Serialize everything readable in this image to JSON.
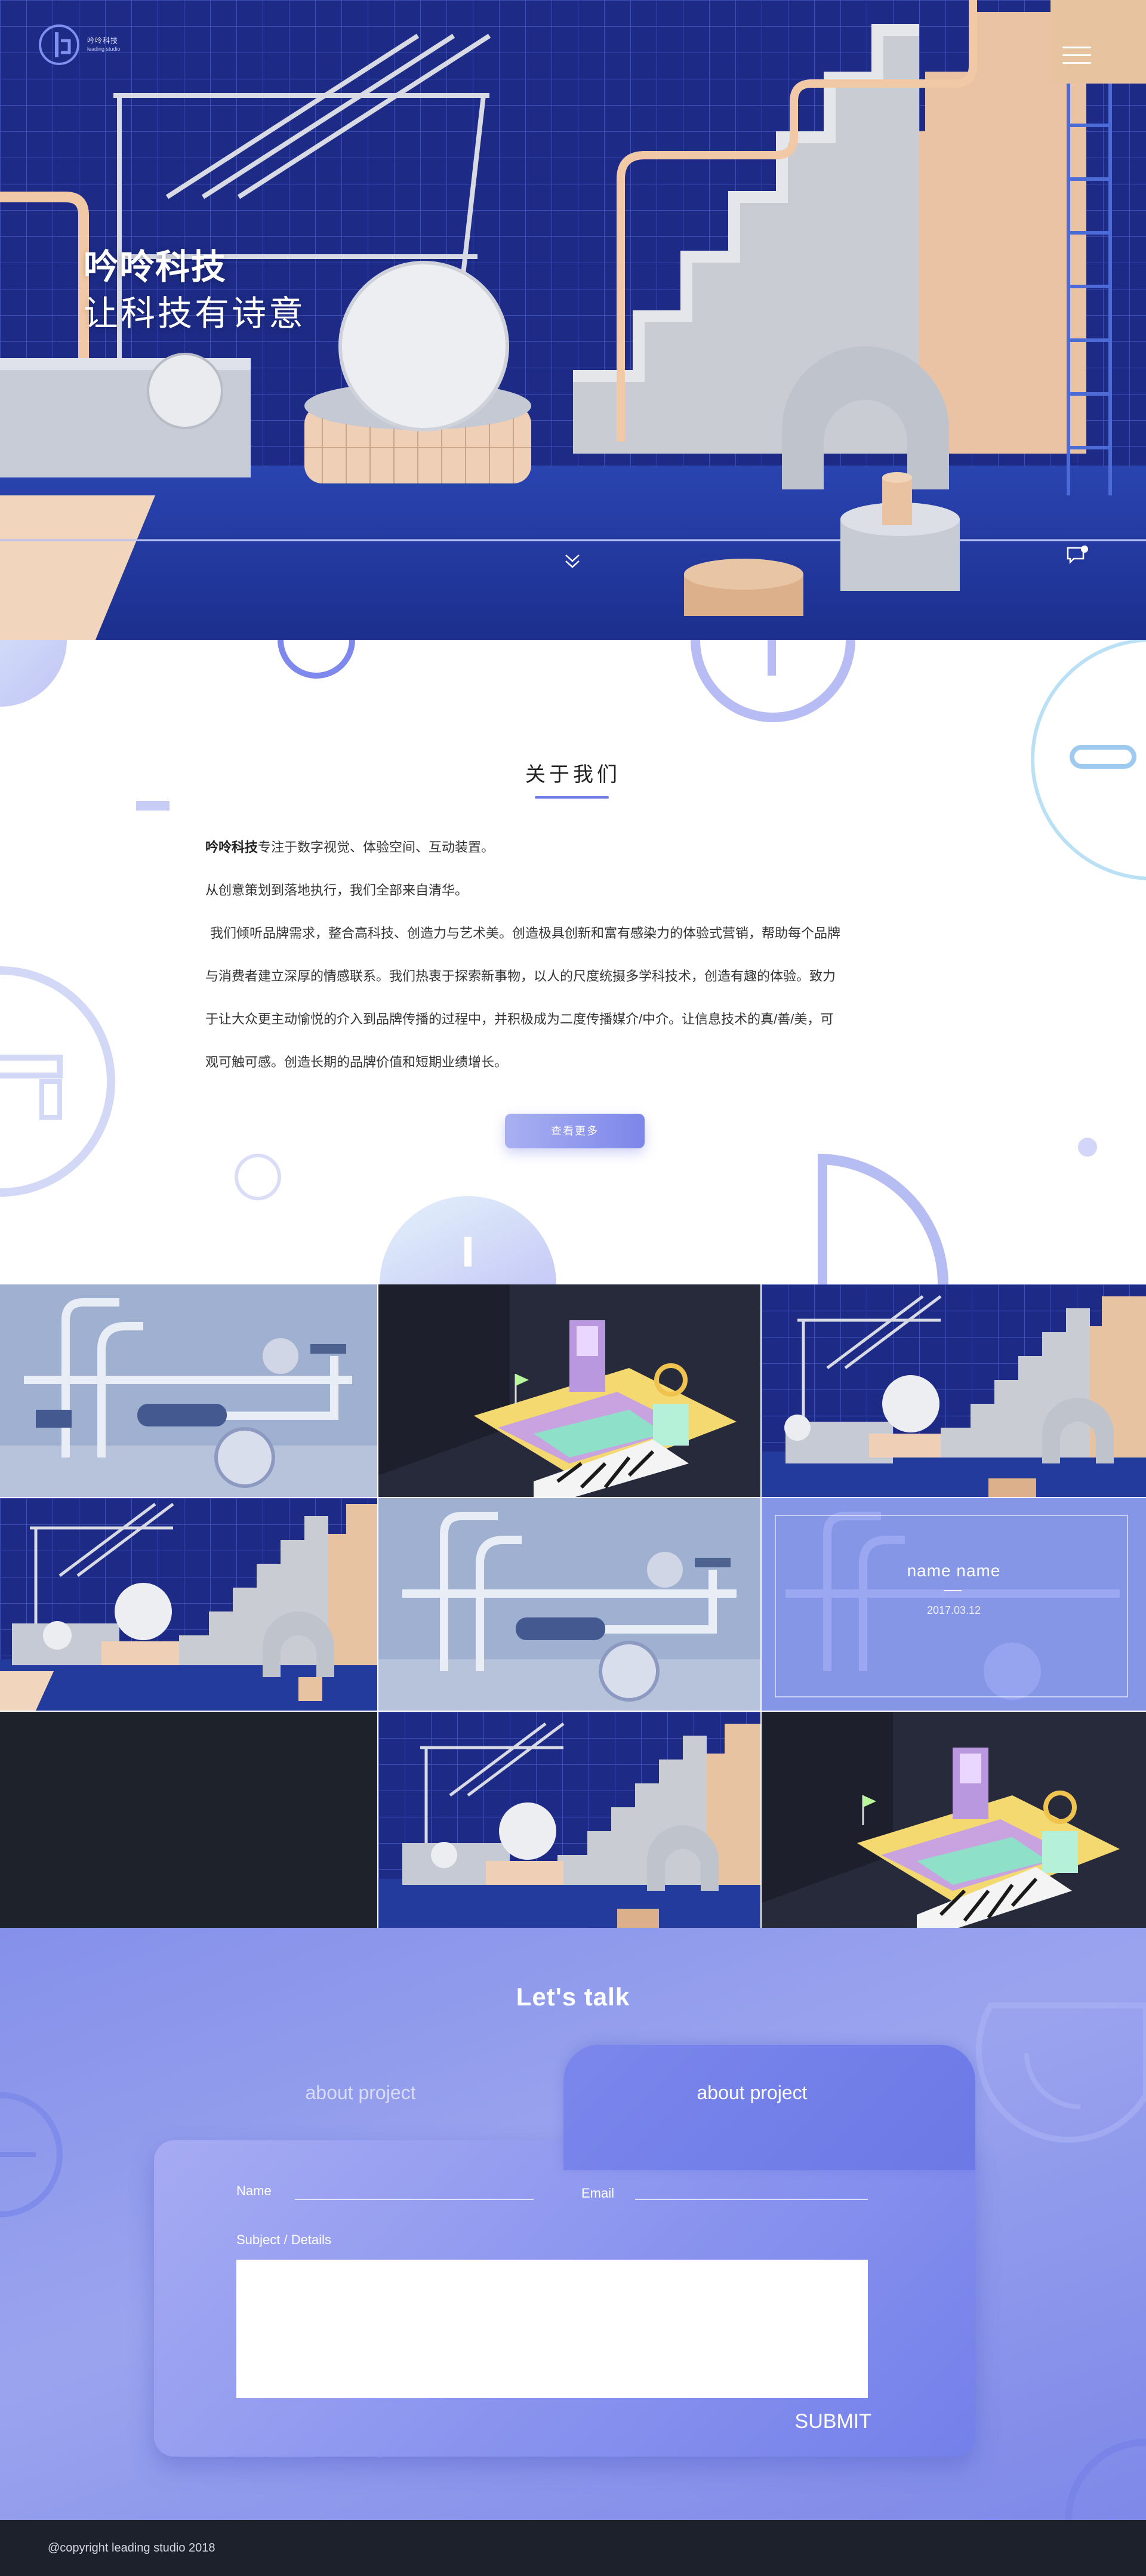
{
  "brand": {
    "logo_cn": "吟呤科技",
    "logo_en": "leading studio",
    "accent": "#6d7be6",
    "hero_blue": "#1f2d8c"
  },
  "hero": {
    "title": "吟呤科技",
    "subtitle": "让科技有诗意"
  },
  "about": {
    "title": "关于我们",
    "intro_brand": "吟呤科技",
    "intro_rest": "专注于数字视觉、体验空间、互动装置。",
    "line2": "从创意策划到落地执行，我们全部来自清华。",
    "line3": "我们倾听品牌需求，整合高科技、创造力与艺术美。创造极具创新和富有感染力的体验式营销，帮助每个品牌",
    "line4": "与消费者建立深厚的情感联系。我们热衷于探索新事物，以人的尺度统摄多学科技术，创造有趣的体验。致力",
    "line5": "于让大众更主动愉悦的介入到品牌传播的过程中，并积极成为二度传播媒介/中介。让信息技术的真/善/美，可",
    "line6": "观可触可感。创造长期的品牌价值和短期业绩增长。",
    "button": "查看更多"
  },
  "gallery": {
    "hover_name": "name name",
    "hover_date": "2017.03.12"
  },
  "contact": {
    "title": "Let's talk",
    "tab_inactive": "about project",
    "tab_active": "about project",
    "name_label": "Name",
    "email_label": "Email",
    "subject_label": "Subject / Details",
    "submit_label": "SUBMIT"
  },
  "footer": {
    "copyright": "@copyright leading studio 2018"
  }
}
